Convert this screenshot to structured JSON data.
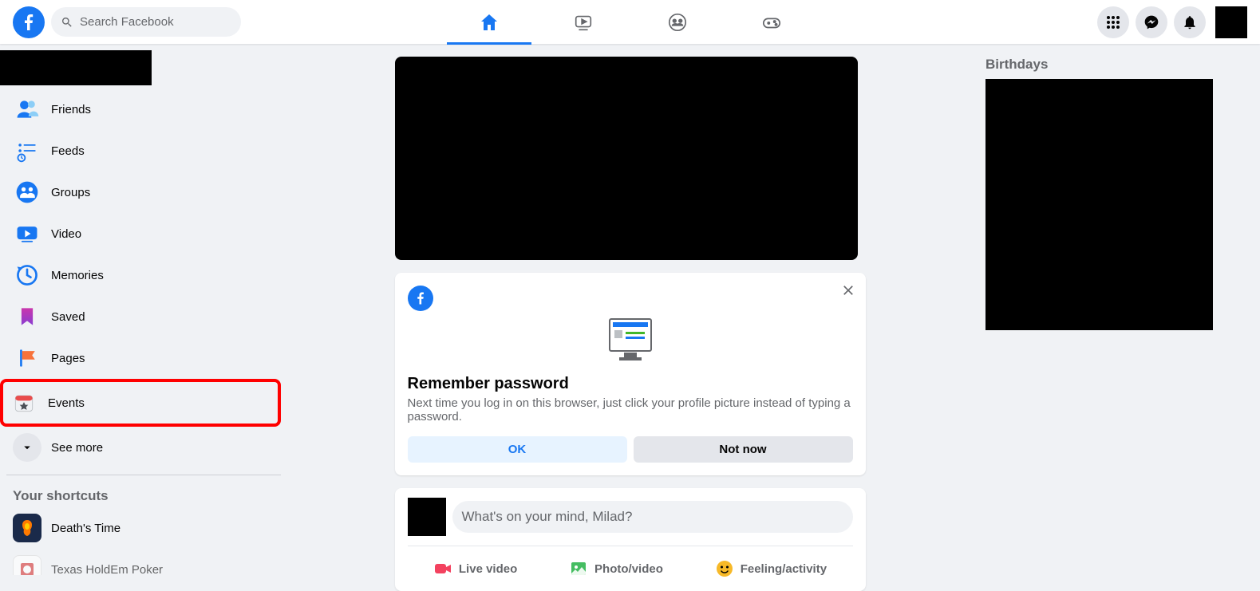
{
  "header": {
    "search_placeholder": "Search Facebook"
  },
  "sidebar": {
    "items": [
      {
        "label": "Friends",
        "icon": "friends-icon"
      },
      {
        "label": "Feeds",
        "icon": "feeds-icon"
      },
      {
        "label": "Groups",
        "icon": "groups-icon"
      },
      {
        "label": "Video",
        "icon": "video-icon"
      },
      {
        "label": "Memories",
        "icon": "memories-icon"
      },
      {
        "label": "Saved",
        "icon": "saved-icon"
      },
      {
        "label": "Pages",
        "icon": "pages-icon"
      },
      {
        "label": "Events",
        "icon": "events-icon"
      }
    ],
    "see_more": "See more",
    "shortcuts_title": "Your shortcuts",
    "shortcuts": [
      {
        "label": "Death's Time"
      },
      {
        "label": "Texas HoldEm Poker"
      }
    ]
  },
  "remember_card": {
    "title": "Remember password",
    "description": "Next time you log in on this browser, just click your profile picture instead of typing a password.",
    "ok_label": "OK",
    "not_now_label": "Not now"
  },
  "composer": {
    "placeholder": "What's on your mind, Milad?",
    "live_video": "Live video",
    "photo_video": "Photo/video",
    "feeling": "Feeling/activity"
  },
  "right": {
    "birthdays_title": "Birthdays"
  }
}
